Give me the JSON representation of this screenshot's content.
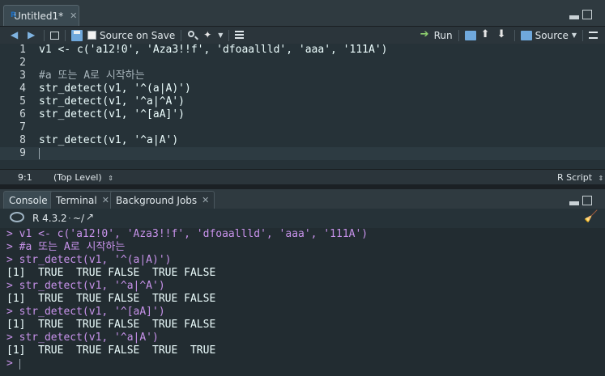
{
  "editor": {
    "tab_title": "Untitled1*",
    "toolbar": {
      "source_on_save": "Source on Save",
      "run": "Run",
      "source": "Source"
    },
    "lines": [
      {
        "num": "1",
        "text": "v1 <- c('a12!0', 'Aza3!!f', 'dfoaallld', 'aaa', '111A')"
      },
      {
        "num": "2",
        "text": ""
      },
      {
        "num": "3",
        "text": "#a 또는 A로 시작하는"
      },
      {
        "num": "4",
        "text": "str_detect(v1, '^(a|A)')"
      },
      {
        "num": "5",
        "text": "str_detect(v1, '^a|^A')"
      },
      {
        "num": "6",
        "text": "str_detect(v1, '^[aA]')"
      },
      {
        "num": "7",
        "text": ""
      },
      {
        "num": "8",
        "text": "str_detect(v1, '^a|A')"
      },
      {
        "num": "9",
        "text": ""
      }
    ],
    "status": {
      "position": "9:1",
      "scope": "(Top Level)",
      "file_type": "R Script"
    }
  },
  "console": {
    "tabs": [
      "Console",
      "Terminal",
      "Background Jobs"
    ],
    "r_version": "R 4.3.2",
    "working_dir": "~/",
    "lines": [
      {
        "kind": "cmd",
        "text": "> v1 <- c('a12!0', 'Aza3!!f', 'dfoaallld', 'aaa', '111A')"
      },
      {
        "kind": "cmd",
        "text": "> #a 또는 A로 시작하는"
      },
      {
        "kind": "cmd",
        "text": "> str_detect(v1, '^(a|A)')"
      },
      {
        "kind": "out",
        "text": "[1]  TRUE  TRUE FALSE  TRUE FALSE"
      },
      {
        "kind": "cmd",
        "text": "> str_detect(v1, '^a|^A')"
      },
      {
        "kind": "out",
        "text": "[1]  TRUE  TRUE FALSE  TRUE FALSE"
      },
      {
        "kind": "cmd",
        "text": "> str_detect(v1, '^[aA]')"
      },
      {
        "kind": "out",
        "text": "[1]  TRUE  TRUE FALSE  TRUE FALSE"
      },
      {
        "kind": "cmd",
        "text": "> str_detect(v1, '^a|A')"
      },
      {
        "kind": "out",
        "text": "[1]  TRUE  TRUE FALSE  TRUE  TRUE"
      },
      {
        "kind": "cmd",
        "text": "> "
      }
    ]
  }
}
